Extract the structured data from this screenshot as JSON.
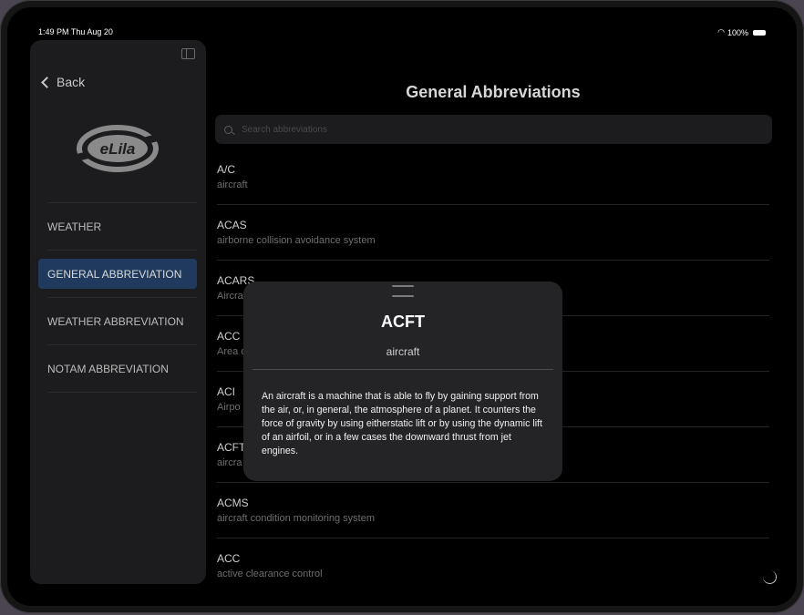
{
  "status": {
    "time": "1:49 PM  Thu Aug 20",
    "battery": "100%"
  },
  "sidebar": {
    "back_label": "Back",
    "logo_text": "eLila",
    "items": [
      {
        "label": "WEATHER"
      },
      {
        "label": "GENERAL ABBREVIATION",
        "active": true
      },
      {
        "label": "WEATHER ABBREVIATION"
      },
      {
        "label": "NOTAM ABBREVIATION"
      }
    ]
  },
  "main": {
    "title": "General Abbreviations",
    "search_placeholder": "Search abbreviations",
    "items": [
      {
        "code": "A/C",
        "desc": "aircraft"
      },
      {
        "code": "ACAS",
        "desc": "airborne collision avoidance system"
      },
      {
        "code": "ACARS",
        "desc": "Aircra"
      },
      {
        "code": "ACC",
        "desc": "Area c"
      },
      {
        "code": "ACI",
        "desc": "Airpo"
      },
      {
        "code": "ACFT",
        "desc": "aircra"
      },
      {
        "code": "ACMS",
        "desc": "aircraft condition monitoring system"
      },
      {
        "code": "ACC",
        "desc": "active clearance control"
      }
    ]
  },
  "popup": {
    "title": "ACFT",
    "subtitle": "aircraft",
    "body": "An aircraft is a machine that is able to fly by gaining support from the air, or, in general, the atmosphere of a planet. It counters the force of gravity by using eitherstatic lift or by using the dynamic lift of an airfoil, or in a few cases the downward thrust from jet engines."
  },
  "colors": {
    "active_item_bg": "#1f3a5c",
    "popup_bg": "#242426",
    "logo": "#8a8a8a"
  }
}
